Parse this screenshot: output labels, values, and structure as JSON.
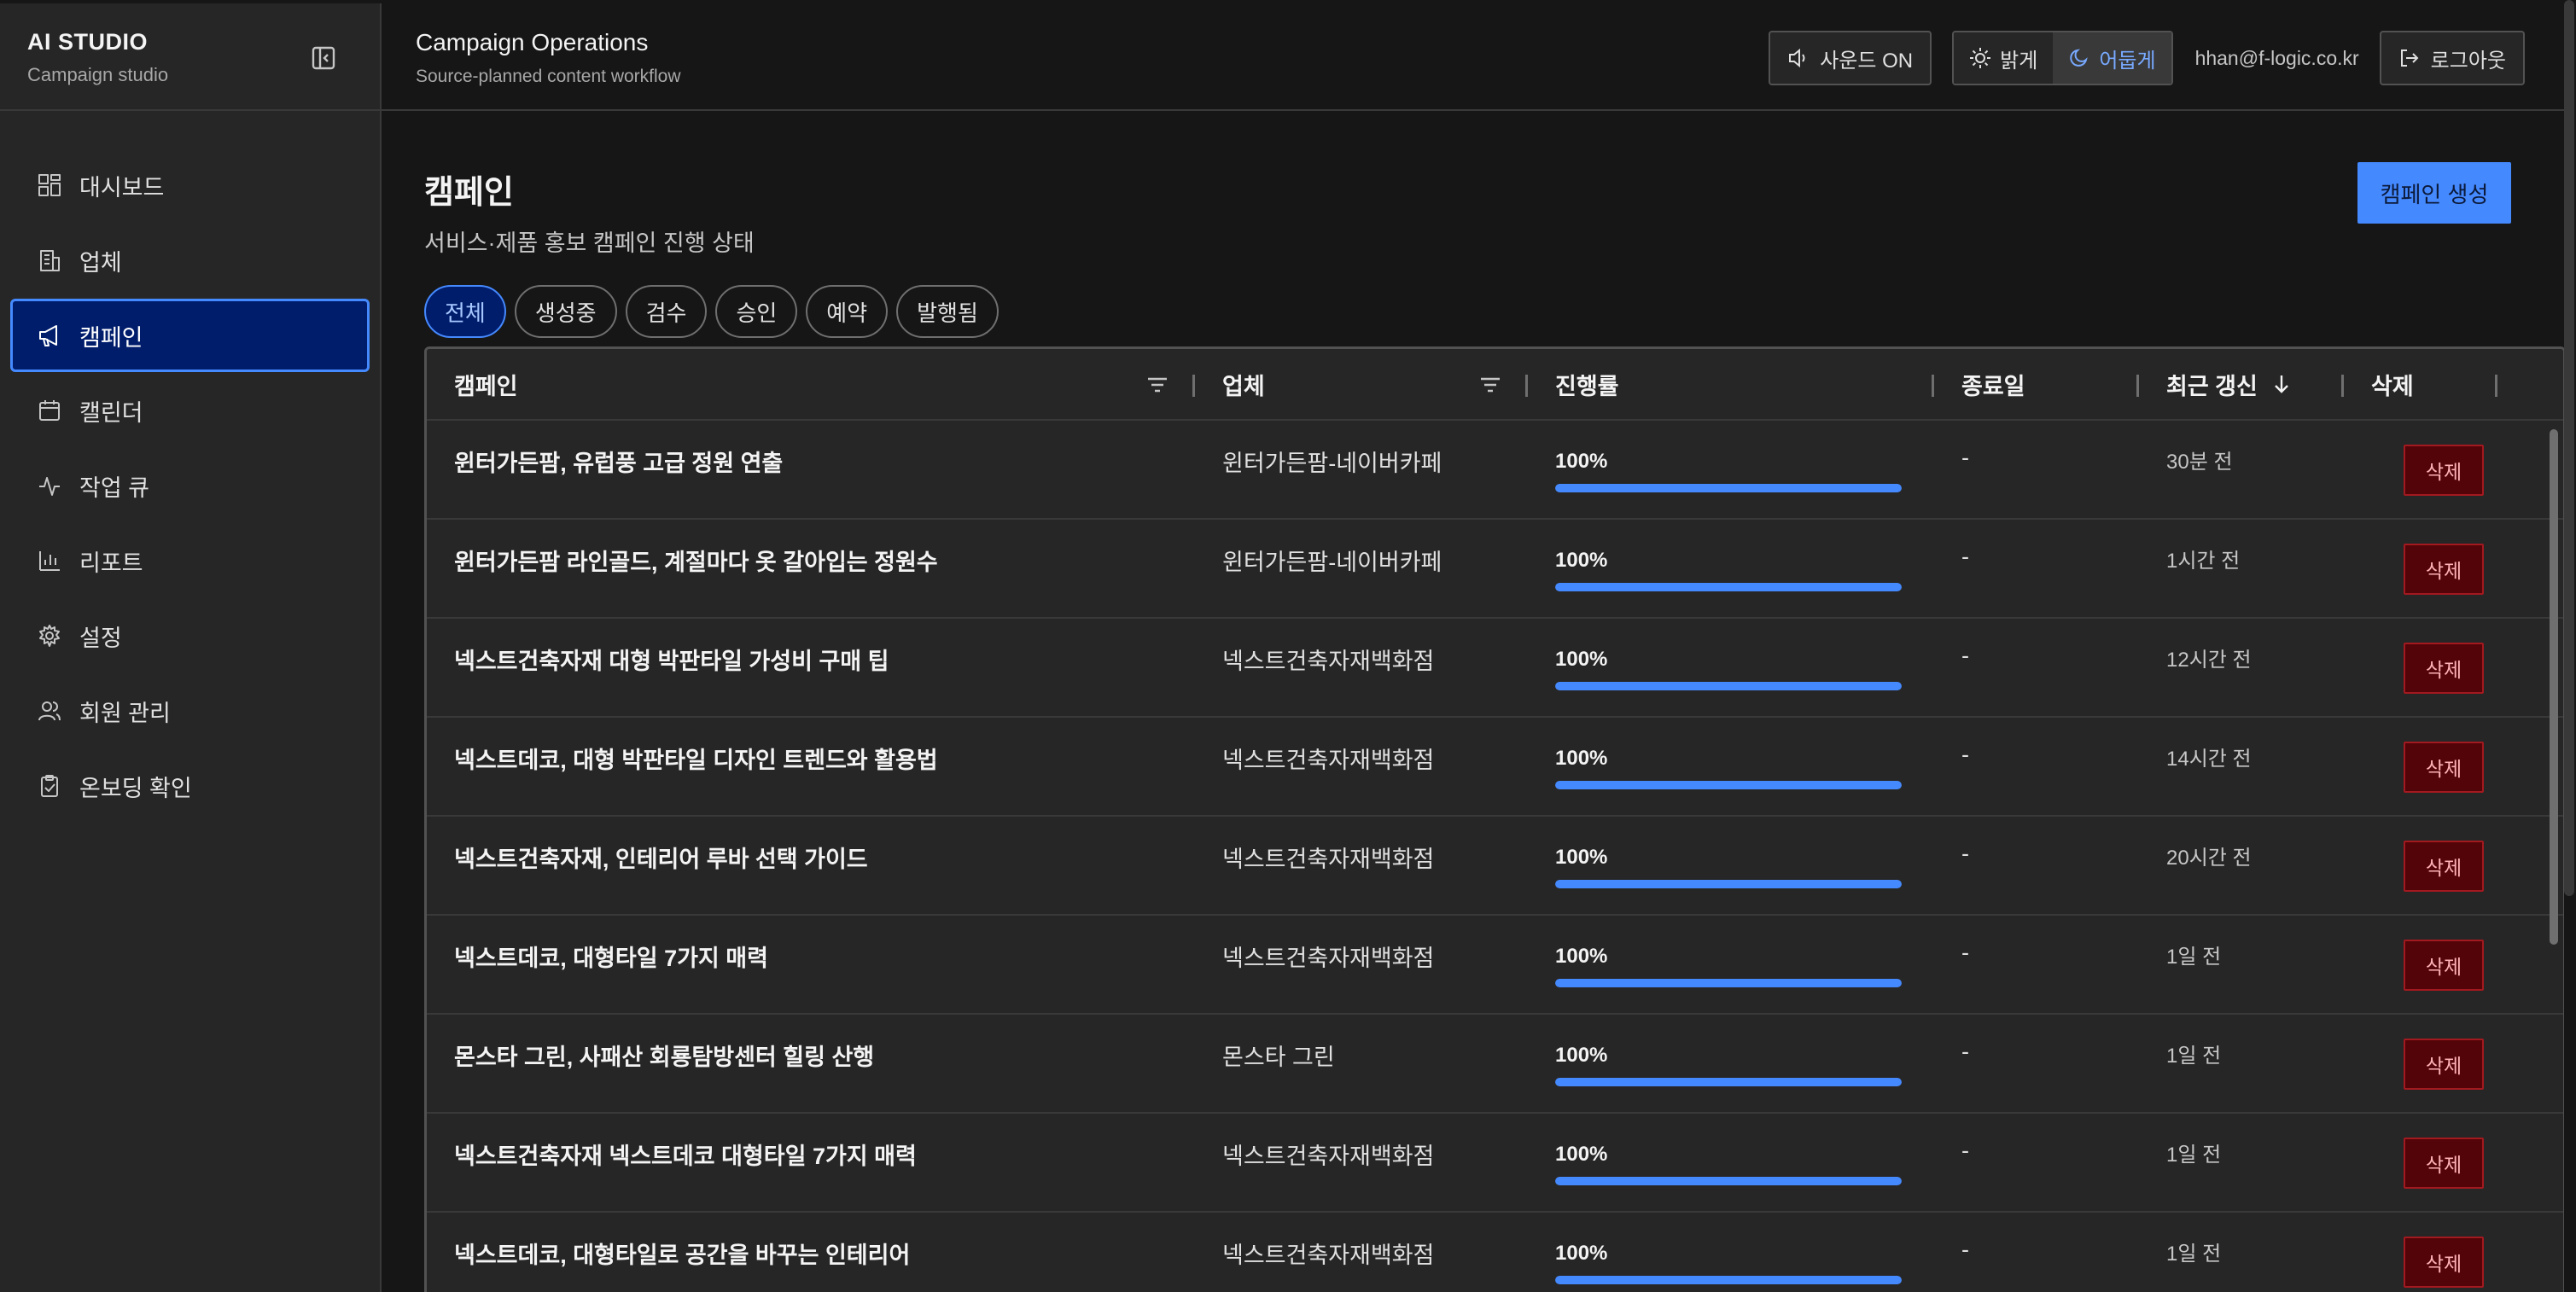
{
  "sidebar": {
    "brand_title": "AI STUDIO",
    "brand_sub": "Campaign studio",
    "items": [
      {
        "label": "대시보드",
        "icon": "dashboard-icon"
      },
      {
        "label": "업체",
        "icon": "building-icon"
      },
      {
        "label": "캠페인",
        "icon": "megaphone-icon",
        "active": true
      },
      {
        "label": "캘린더",
        "icon": "calendar-icon"
      },
      {
        "label": "작업 큐",
        "icon": "activity-icon"
      },
      {
        "label": "리포트",
        "icon": "bar-chart-icon"
      },
      {
        "label": "설정",
        "icon": "gear-icon"
      },
      {
        "label": "회원 관리",
        "icon": "users-icon"
      },
      {
        "label": "온보딩 확인",
        "icon": "clipboard-check-icon"
      }
    ]
  },
  "header": {
    "title": "Campaign Operations",
    "subtitle": "Source-planned content workflow",
    "sound_label": "사운드 ON",
    "theme_light": "밝게",
    "theme_dark": "어둡게",
    "user_email": "hhan@f-logic.co.kr",
    "logout_label": "로그아웃"
  },
  "page": {
    "title": "캠페인",
    "subtitle": "서비스·제품 홍보 캠페인 진행 상태",
    "create_label": "캠페인 생성",
    "filters": [
      "전체",
      "생성중",
      "검수",
      "승인",
      "예약",
      "발행됨"
    ],
    "active_filter": "전체"
  },
  "table": {
    "columns": [
      "캠페인",
      "업체",
      "진행률",
      "종료일",
      "최근 갱신",
      "삭제"
    ],
    "delete_label": "삭제",
    "rows": [
      {
        "name": "윈터가든팜, 유럽풍 고급 정원 연출",
        "vendor": "윈터가든팜-네이버카페",
        "progress": 100,
        "progress_label": "100%",
        "end": "-",
        "updated": "30분 전"
      },
      {
        "name": "윈터가든팜 라인골드, 계절마다 옷 갈아입는 정원수",
        "vendor": "윈터가든팜-네이버카페",
        "progress": 100,
        "progress_label": "100%",
        "end": "-",
        "updated": "1시간 전"
      },
      {
        "name": "넥스트건축자재 대형 박판타일 가성비 구매 팁",
        "vendor": "넥스트건축자재백화점",
        "progress": 100,
        "progress_label": "100%",
        "end": "-",
        "updated": "12시간 전"
      },
      {
        "name": "넥스트데코, 대형 박판타일 디자인 트렌드와 활용법",
        "vendor": "넥스트건축자재백화점",
        "progress": 100,
        "progress_label": "100%",
        "end": "-",
        "updated": "14시간 전"
      },
      {
        "name": "넥스트건축자재, 인테리어 루바 선택 가이드",
        "vendor": "넥스트건축자재백화점",
        "progress": 100,
        "progress_label": "100%",
        "end": "-",
        "updated": "20시간 전"
      },
      {
        "name": "넥스트데코, 대형타일 7가지 매력",
        "vendor": "넥스트건축자재백화점",
        "progress": 100,
        "progress_label": "100%",
        "end": "-",
        "updated": "1일 전"
      },
      {
        "name": "몬스타 그린, 사패산 회룡탐방센터 힐링 산행",
        "vendor": "몬스타 그린",
        "progress": 100,
        "progress_label": "100%",
        "end": "-",
        "updated": "1일 전"
      },
      {
        "name": "넥스트건축자재 넥스트데코 대형타일 7가지 매력",
        "vendor": "넥스트건축자재백화점",
        "progress": 100,
        "progress_label": "100%",
        "end": "-",
        "updated": "1일 전"
      },
      {
        "name": "넥스트데코, 대형타일로 공간을 바꾸는 인테리어",
        "vendor": "넥스트건축자재백화점",
        "progress": 100,
        "progress_label": "100%",
        "end": "-",
        "updated": "1일 전"
      }
    ]
  },
  "colors": {
    "accent": "#4589ff",
    "active_nav_bg": "#001d6c",
    "delete_bg": "#520408",
    "delete_border": "#a2191f"
  }
}
